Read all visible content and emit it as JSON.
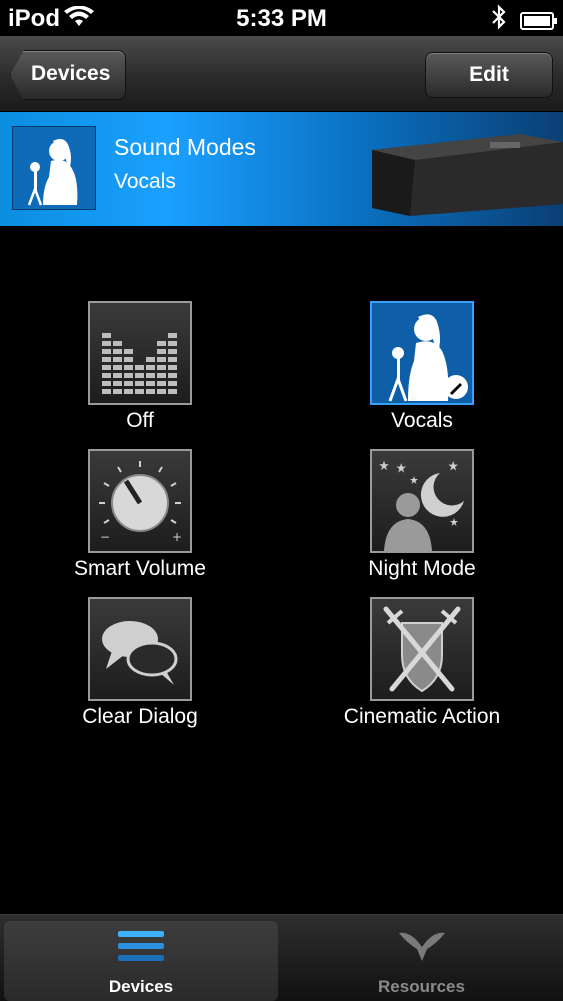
{
  "status_bar": {
    "carrier": "iPod",
    "time": "5:33 PM"
  },
  "nav": {
    "back_label": "Devices",
    "edit_label": "Edit"
  },
  "banner": {
    "title": "Sound Modes",
    "subtitle": "Vocals"
  },
  "modes": [
    {
      "label": "Off",
      "icon": "equalizer-icon",
      "selected": false
    },
    {
      "label": "Vocals",
      "icon": "singer-icon",
      "selected": true
    },
    {
      "label": "Smart Volume",
      "icon": "volume-knob-icon",
      "selected": false
    },
    {
      "label": "Night Mode",
      "icon": "night-moon-icon",
      "selected": false
    },
    {
      "label": "Clear Dialog",
      "icon": "speech-bubbles-icon",
      "selected": false
    },
    {
      "label": "Cinematic Action",
      "icon": "crossed-swords-icon",
      "selected": false
    }
  ],
  "tabs": [
    {
      "label": "Devices",
      "icon": "devices-icon",
      "active": true
    },
    {
      "label": "Resources",
      "icon": "resources-icon",
      "active": false
    }
  ],
  "colors": {
    "accent_blue": "#1aa0ff",
    "selected_tile": "#0e5fa8",
    "inactive_tab_text": "#8a8a8a"
  }
}
